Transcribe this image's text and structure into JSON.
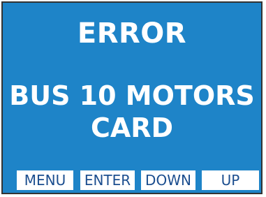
{
  "screen": {
    "title": "ERROR",
    "message_line1": "BUS 10 MOTORS",
    "message_line2": "CARD"
  },
  "softkeys": {
    "menu": "MENU",
    "enter": "ENTER",
    "down": "DOWN",
    "up": "UP"
  },
  "colors": {
    "screen_background": "#1e84c8",
    "text": "#ffffff",
    "softkey_background": "#ffffff",
    "softkey_text": "#1b4e8f"
  }
}
